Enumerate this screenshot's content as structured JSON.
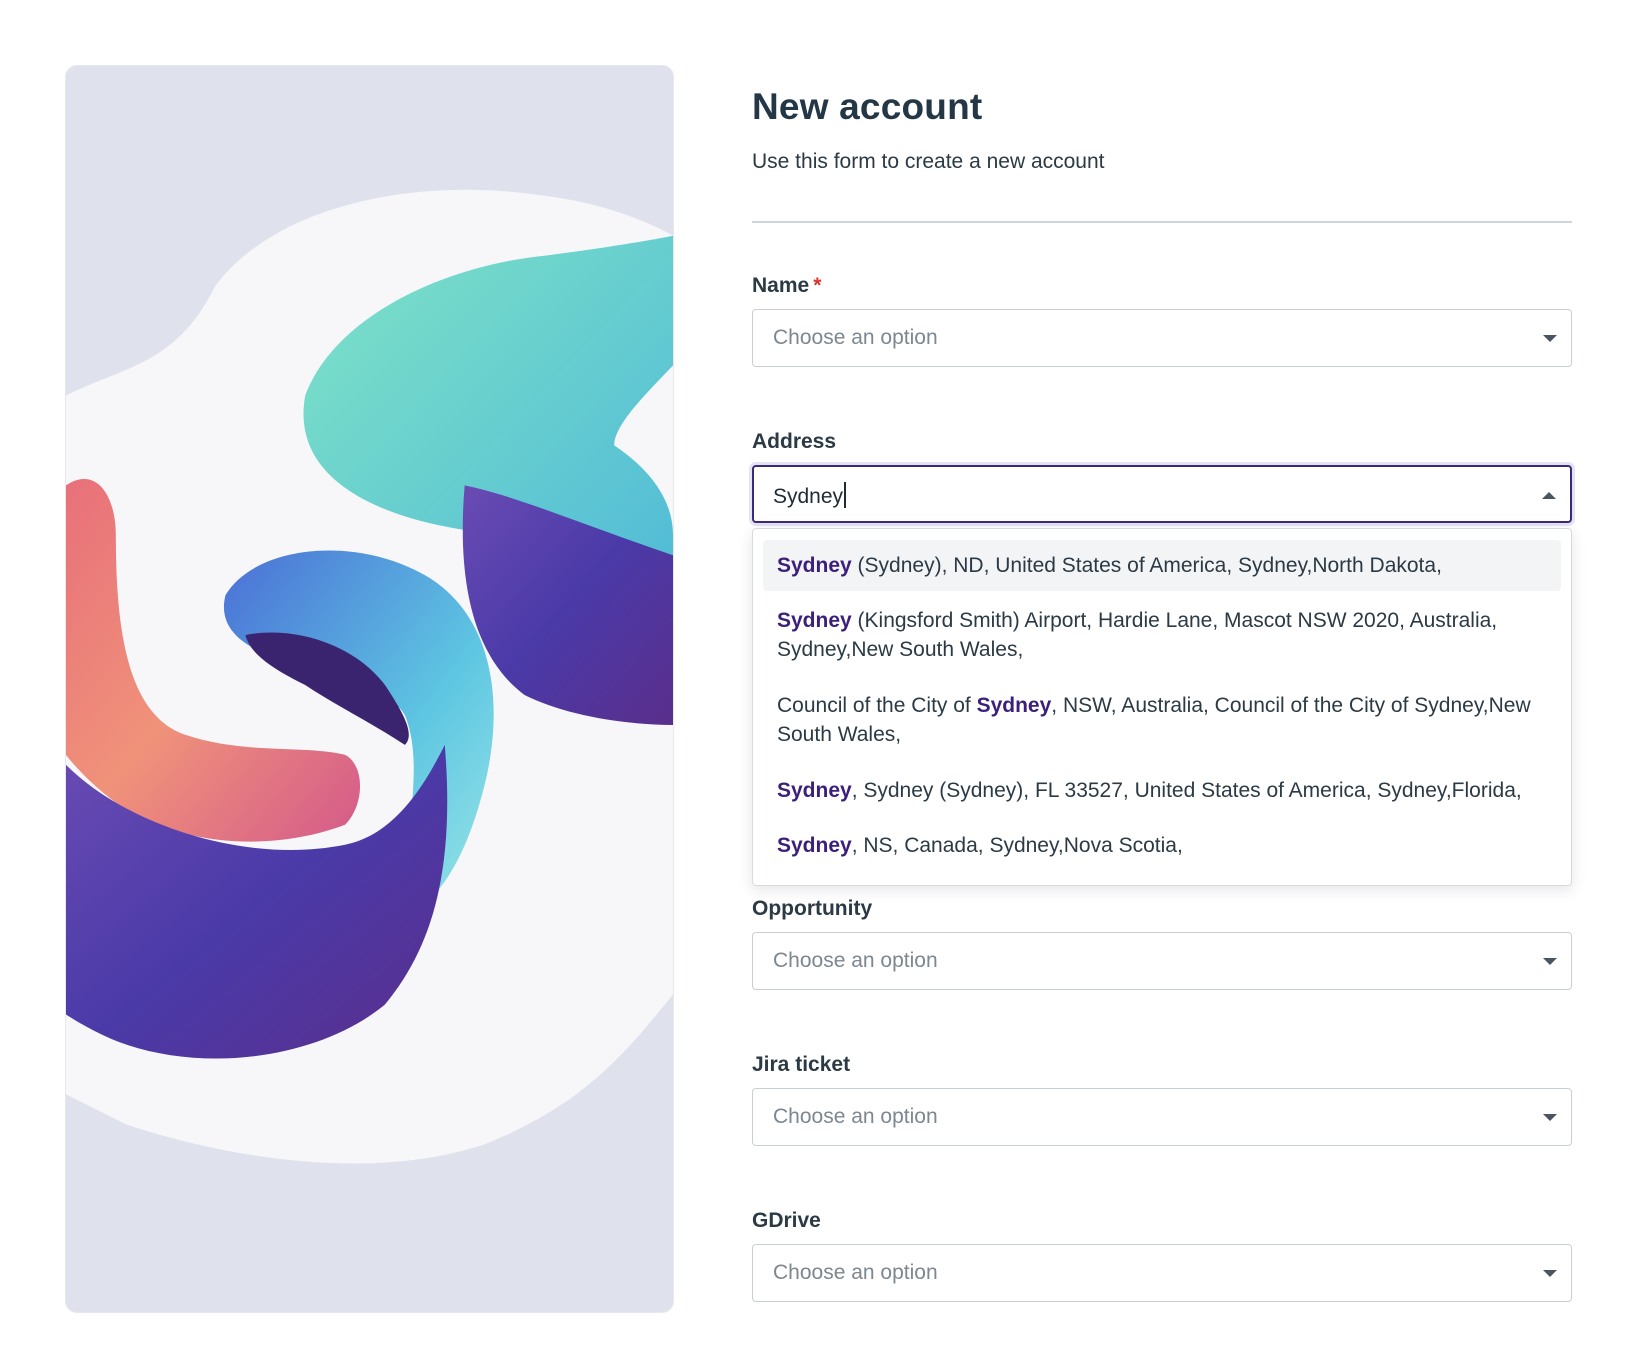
{
  "header": {
    "title": "New account",
    "subtitle": "Use this form to create a new account"
  },
  "fields": {
    "name": {
      "label": "Name",
      "required_mark": "*",
      "placeholder": "Choose an option"
    },
    "address": {
      "label": "Address",
      "value": "Sydney"
    },
    "opportunity": {
      "label": "Opportunity",
      "placeholder": "Choose an option"
    },
    "jira": {
      "label": "Jira ticket",
      "placeholder": "Choose an option"
    },
    "gdrive": {
      "label": "GDrive",
      "placeholder": "Choose an option"
    }
  },
  "address_suggestions": [
    {
      "before": "",
      "match": "Sydney",
      "after": " (Sydney), ND, United States of America, Sydney,North Dakota,"
    },
    {
      "before": "",
      "match": "Sydney",
      "after": " (Kingsford Smith) Airport, Hardie Lane, Mascot NSW 2020, Australia, Sydney,New South Wales,"
    },
    {
      "before": "Council of the City of ",
      "match": "Sydney",
      "after": ", NSW, Australia, Council of the City of Sydney,New South Wales,"
    },
    {
      "before": "",
      "match": "Sydney",
      "after": ", Sydney (Sydney), FL 33527, United States of America, Sydney,Florida,"
    },
    {
      "before": "",
      "match": "Sydney",
      "after": ", NS, Canada, Sydney,Nova Scotia,"
    }
  ],
  "colors": {
    "highlight": "#3b1f7a",
    "focus_border": "#3b2a7a",
    "required": "#d9342b"
  },
  "icons": {
    "select_caret": "chevron-down-icon",
    "open_caret": "chevron-up-icon"
  }
}
